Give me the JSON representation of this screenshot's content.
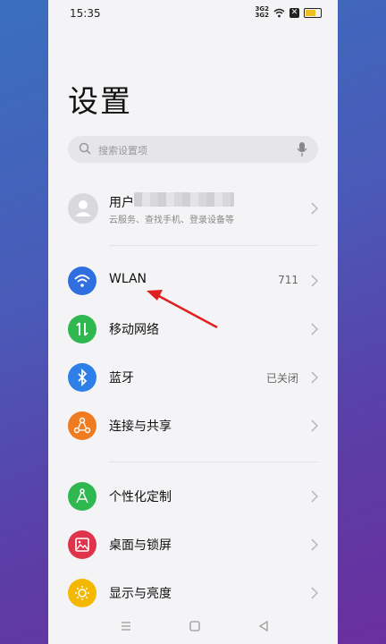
{
  "status_bar": {
    "time": "15:35",
    "signal_text": "3G2\n3G2",
    "battery_x": "✕"
  },
  "page_title": "设置",
  "search": {
    "placeholder": "搜索设置项"
  },
  "account": {
    "name_prefix": "用户",
    "subtitle": "云服务、查找手机、登录设备等"
  },
  "items": [
    {
      "label": "WLAN",
      "value": "711",
      "icon": "wifi-icon",
      "color": "#2f6fe0"
    },
    {
      "label": "移动网络",
      "value": "",
      "icon": "mobile-data-icon",
      "color": "#2fb84f"
    },
    {
      "label": "蓝牙",
      "value": "已关闭",
      "icon": "bluetooth-icon",
      "color": "#2f7fe8"
    },
    {
      "label": "连接与共享",
      "value": "",
      "icon": "share-icon",
      "color": "#f07a20"
    },
    {
      "label": "个性化定制",
      "value": "",
      "icon": "brush-icon",
      "color": "#2fb84f"
    },
    {
      "label": "桌面与锁屏",
      "value": "",
      "icon": "picture-icon",
      "color": "#e0344a"
    },
    {
      "label": "显示与亮度",
      "value": "",
      "icon": "sun-icon",
      "color": "#f5b800"
    }
  ],
  "nav": {
    "menu": "menu-icon",
    "home": "home-icon",
    "back": "back-icon"
  },
  "annotation_color": "#e02020"
}
